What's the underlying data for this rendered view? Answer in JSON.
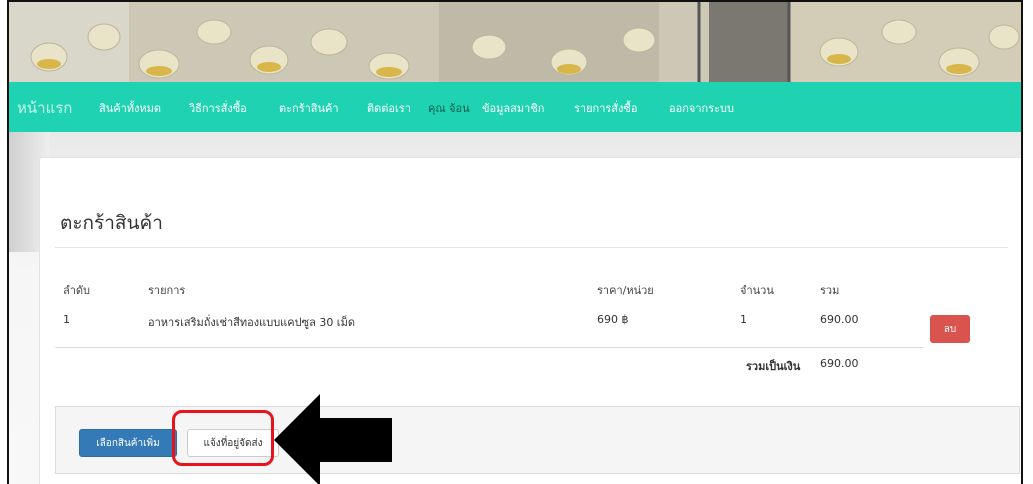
{
  "nav": {
    "brand": "หน้าแรก",
    "items": [
      {
        "label": "สินค้าทั้งหมด"
      },
      {
        "label": "วิธีการสั่งซื้อ"
      },
      {
        "label": "ตะกร้าสินค้า"
      },
      {
        "label": "ติดต่อเรา"
      }
    ],
    "user_greeting": "คุณ จ้อน",
    "member_items": [
      {
        "label": "ข้อมูลสมาชิก"
      },
      {
        "label": "รายการสั่งซื้อ"
      },
      {
        "label": "ออกจากระบบ"
      }
    ]
  },
  "cart": {
    "title": "ตะกร้าสินค้า",
    "columns": [
      "ลำดับ",
      "รายการ",
      "ราคา/หน่วย",
      "จำนวน",
      "รวม"
    ],
    "rows": [
      {
        "no": "1",
        "item": "อาหารเสริมถั่งเช่าสีทองแบบแคปซูล 30 เม็ด",
        "price": "690 ฿",
        "qty": "1",
        "total": "690.00",
        "delete_label": "ลบ"
      }
    ],
    "grand_total_label": "รวมเป็นเงิน",
    "grand_total_value": "690.00"
  },
  "actions": {
    "continue_shopping": "เลือกสินค้าเพิ่ม",
    "shipping_address": "แจ้งที่อยู่จัดส่ง"
  },
  "colors": {
    "navbar": "#1fd3b2",
    "primary": "#337ab7",
    "danger": "#d9534f",
    "highlight": "#e8141c"
  }
}
